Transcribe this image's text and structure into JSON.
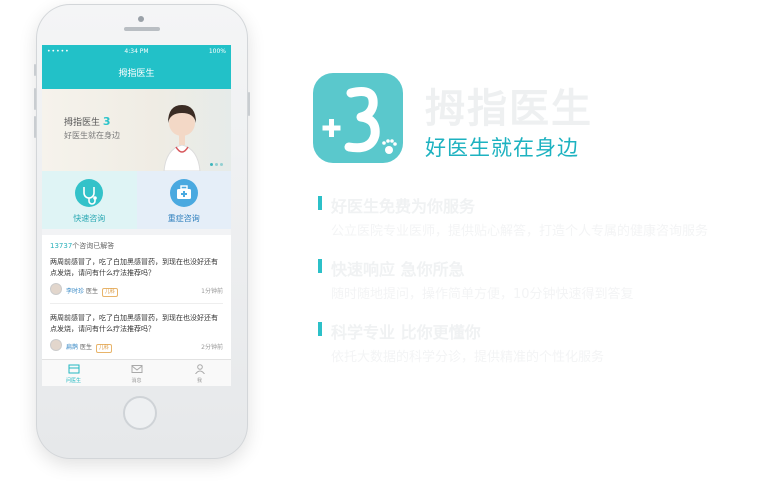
{
  "phone": {
    "status": {
      "carrier": "•••••",
      "time": "4:34 PM",
      "battery": "100%"
    },
    "title": "拇指医生",
    "banner": {
      "brand": "拇指医生",
      "brand_mark": "3",
      "slogan": "好医生就在身边"
    },
    "quick": [
      {
        "label": "快速咨询",
        "icon": "stethoscope-icon"
      },
      {
        "label": "重症咨询",
        "icon": "medical-kit-icon"
      }
    ],
    "feed": {
      "count": "13737",
      "count_suffix": "个咨询已解答",
      "posts": [
        {
          "text": "两周前感冒了，吃了白加黑感冒药，到现在也没好还有点发烧，请问有什么疗法推荐吗？",
          "doctor": "李时珍",
          "title": "医生",
          "dept": "儿科",
          "ago": "1分钟前"
        },
        {
          "text": "两周前感冒了，吃了白加黑感冒药，到现在也没好还有点发烧，请问有什么疗法推荐吗？",
          "doctor": "扁鹊",
          "title": "医生",
          "dept": "儿科",
          "ago": "2分钟前"
        }
      ]
    },
    "tabs": [
      {
        "label": "问医生",
        "icon": "doctor-tab-icon"
      },
      {
        "label": "消息",
        "icon": "mail-icon"
      },
      {
        "label": "我",
        "icon": "user-icon"
      }
    ]
  },
  "right": {
    "app_name": "拇指医生",
    "tagline": "好医生就在身边",
    "features": [
      {
        "title": "好医生免费为你服务",
        "desc": "公立医院专业医师，提供贴心解答，打造个人专属的健康咨询服务"
      },
      {
        "title": "快速响应 急你所急",
        "desc": "随时随地提问，操作简单方便，10分钟快速得到答复"
      },
      {
        "title": "科学专业 比你更懂你",
        "desc": "依托大数据的科学分诊，提供精准的个性化服务"
      }
    ]
  },
  "colors": {
    "accent": "#22c1c8",
    "tagline": "#1db2c0",
    "link": "#2e7fbd"
  }
}
